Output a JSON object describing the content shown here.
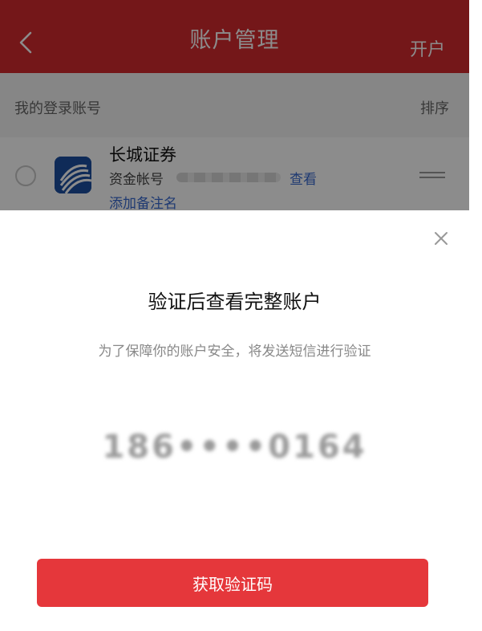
{
  "navbar": {
    "title": "账户管理",
    "action_label": "开户",
    "back_icon": "chevron-left-icon",
    "color": "#d42a2f"
  },
  "accounts_section": {
    "title": "我的登录账号",
    "sort_label": "排序"
  },
  "account": {
    "broker_name": "长城证券",
    "fund_account_label": "资金帐号",
    "view_label": "查看",
    "add_remark_label": "添加备注名",
    "logo_icon": "broker-logo-icon"
  },
  "dialog": {
    "title": "验证后查看完整账户",
    "subtitle": "为了保障你的账户安全，将发送短信进行验证",
    "phone": "186••••0164",
    "button_label": "获取验证码",
    "close_icon": "close-icon",
    "button_color": "#e5373b"
  }
}
